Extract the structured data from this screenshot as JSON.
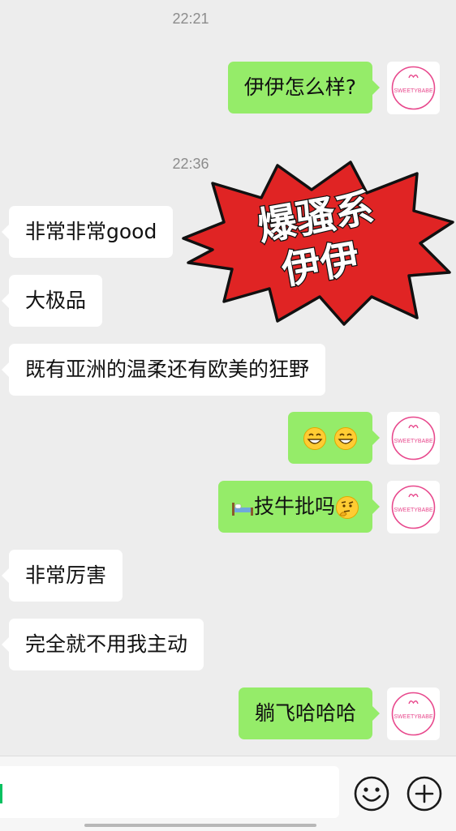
{
  "colors": {
    "background": "#ededed",
    "incoming_bubble": "#ffffff",
    "outgoing_bubble": "#95ec69",
    "burst_red": "#e02424",
    "avatar_pink": "#e8498d"
  },
  "timestamps": [
    "22:21",
    "22:36"
  ],
  "messages": [
    {
      "side": "out",
      "text": "伊伊怎么样?"
    },
    {
      "side": "in",
      "text": "非常非常good"
    },
    {
      "side": "in",
      "text": "大极品"
    },
    {
      "side": "in",
      "text": "既有亚洲的温柔还有欧美的狂野"
    },
    {
      "side": "out",
      "text": "",
      "emoji": [
        "grinning-face",
        "grinning-face"
      ]
    },
    {
      "side": "out",
      "text": "技牛批吗",
      "emoji_before": "bed",
      "emoji_after": "thinking-face"
    },
    {
      "side": "in",
      "text": "非常厉害"
    },
    {
      "side": "in",
      "text": "完全就不用我主动"
    },
    {
      "side": "out",
      "text": "躺飞哈哈哈"
    }
  ],
  "avatar": {
    "text": "SWEETYBABE"
  },
  "burst": {
    "line1": "爆骚系",
    "line2": "伊伊"
  },
  "input": {
    "placeholder": ""
  },
  "icons": [
    "emoji-icon",
    "plus-icon"
  ]
}
